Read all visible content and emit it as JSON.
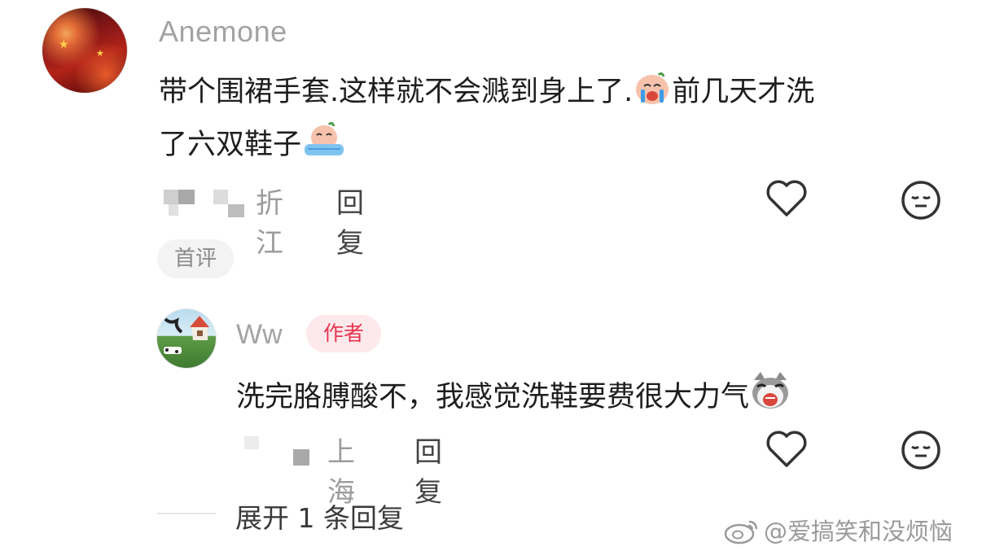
{
  "comment": {
    "username": "Anemone",
    "text_line1": "带个围裙手套.这样就不会溅到身上了.",
    "text_line1_tail": "前几天才洗",
    "text_line2": "了六双鞋子",
    "emoji1": "crying-emoji",
    "emoji2": "crying-emoji",
    "region": "折江",
    "reply_label": "回复",
    "badge": "首评"
  },
  "reply": {
    "username": "Ww",
    "author_badge": "作者",
    "text": "洗完胳膊酸不，我感觉洗鞋要费很大力气",
    "emoji": "crying-cat-emoji",
    "region": "上海",
    "reply_label": "回复"
  },
  "expand": {
    "label": "展开 1 条回复"
  },
  "watermark": {
    "text": "@爱搞笑和没烦恼",
    "icon": "weibo-icon"
  },
  "colors": {
    "author_badge_text": "#e8344f",
    "author_badge_bg": "#fde9ec",
    "muted": "#9c9c9c"
  }
}
